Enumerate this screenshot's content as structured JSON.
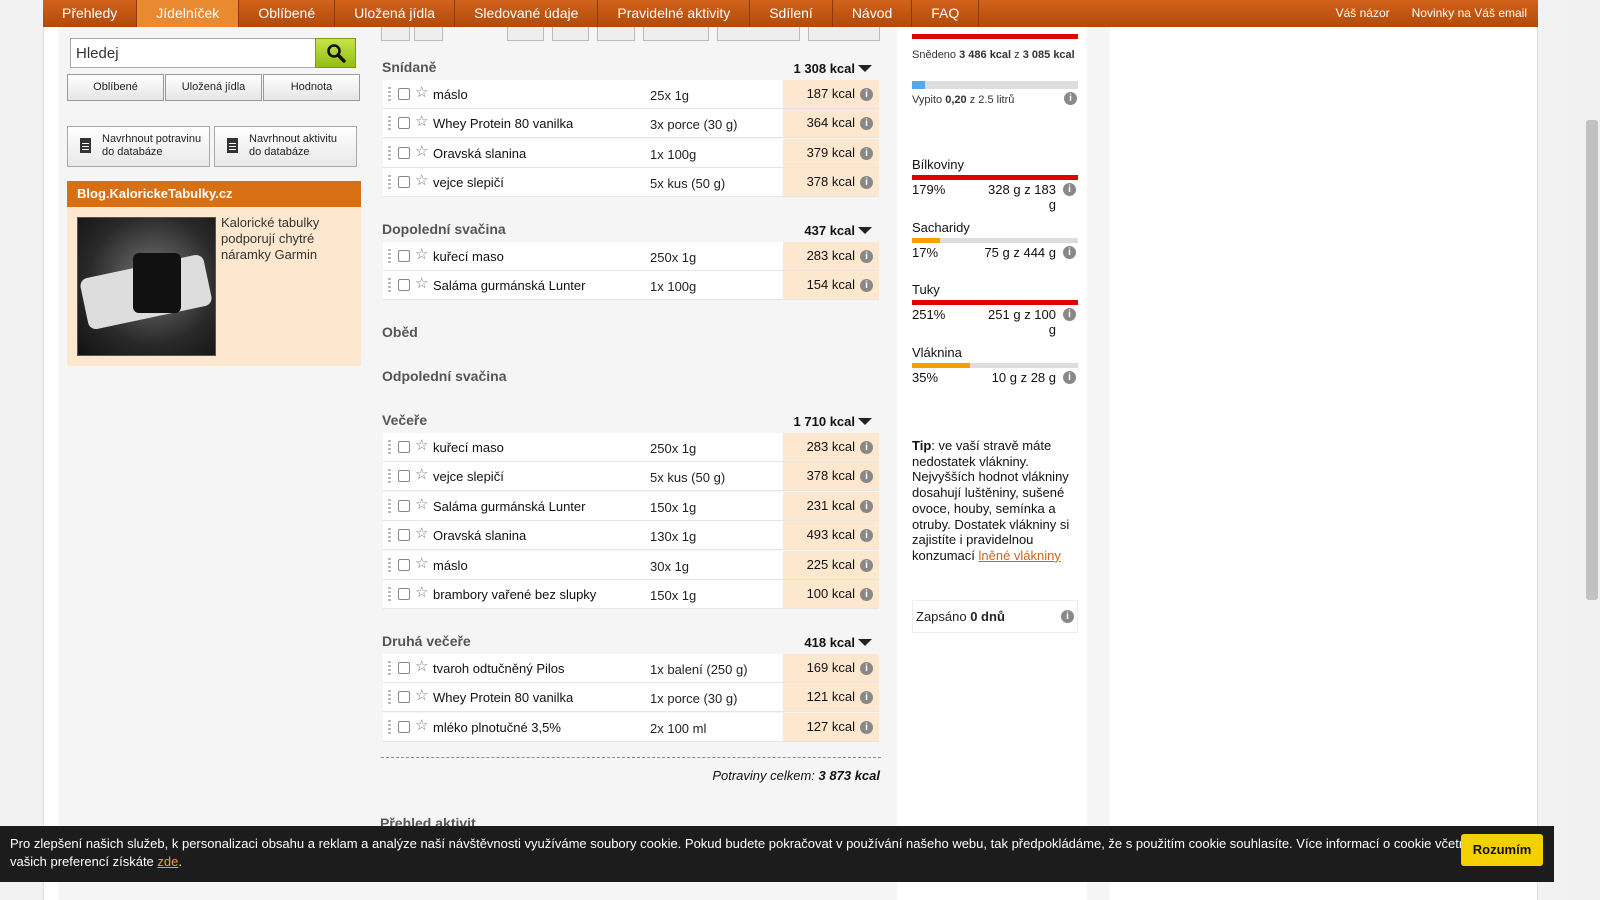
{
  "nav": {
    "tabs": [
      "Přehledy",
      "Jídelníček",
      "Oblíbené",
      "Uložená jídla",
      "Sledované údaje",
      "Pravidelné aktivity",
      "Sdílení",
      "Návod",
      "FAQ"
    ],
    "active_tab": "Jídelníček",
    "right_links": [
      "Váš názor",
      "Novinky na Váš email"
    ]
  },
  "search": {
    "value": "Hledej"
  },
  "filters": [
    "Oblíbené",
    "Uložená jídla",
    "Hodnota"
  ],
  "suggest": {
    "food": "Navrhnout potravinu do databáze",
    "food_l1": "Navrhnout potravinu",
    "food_l2": "do databáze",
    "activity_l1": "Navrhnout aktivitu",
    "activity_l2": "do databáze"
  },
  "blog": {
    "title": "Blog.KalorickeTabulky.cz",
    "text": "Kalorické tabulky podporují chytré náramky Garmin"
  },
  "meals": {
    "snidane": {
      "name": "Snídaně",
      "kcal": "1 308 kcal",
      "items": [
        {
          "food": "máslo",
          "amount": "25x 1g",
          "kcal": "187 kcal"
        },
        {
          "food": "Whey Protein 80 vanilka",
          "amount": "3x porce (30 g)",
          "kcal": "364 kcal"
        },
        {
          "food": "Oravská slanina",
          "amount": "1x 100g",
          "kcal": "379 kcal"
        },
        {
          "food": "vejce slepičí",
          "amount": "5x kus (50 g)",
          "kcal": "378 kcal"
        }
      ]
    },
    "dopoledni": {
      "name": "Dopolední svačina",
      "kcal": "437 kcal",
      "items": [
        {
          "food": "kuřecí maso",
          "amount": "250x 1g",
          "kcal": "283 kcal"
        },
        {
          "food": "Saláma gurmánská Lunter",
          "amount": "1x 100g",
          "kcal": "154 kcal"
        }
      ]
    },
    "obed": {
      "name": "Oběd"
    },
    "odpoledni": {
      "name": "Odpolední svačina"
    },
    "vecere": {
      "name": "Večeře",
      "kcal": "1 710 kcal",
      "items": [
        {
          "food": "kuřecí maso",
          "amount": "250x 1g",
          "kcal": "283 kcal"
        },
        {
          "food": "vejce slepičí",
          "amount": "5x kus (50 g)",
          "kcal": "378 kcal"
        },
        {
          "food": "Saláma gurmánská Lunter",
          "amount": "150x 1g",
          "kcal": "231 kcal"
        },
        {
          "food": "Oravská slanina",
          "amount": "130x 1g",
          "kcal": "493 kcal"
        },
        {
          "food": "máslo",
          "amount": "30x 1g",
          "kcal": "225 kcal"
        },
        {
          "food": "brambory vařené bez slupky",
          "amount": "150x 1g",
          "kcal": "100 kcal"
        }
      ]
    },
    "druha_vecere": {
      "name": "Druhá večeře",
      "kcal": "418 kcal",
      "items": [
        {
          "food": "tvaroh odtučněný Pilos",
          "amount": "1x balení (250 g)",
          "kcal": "169 kcal"
        },
        {
          "food": "Whey Protein 80 vanilka",
          "amount": "1x porce (30 g)",
          "kcal": "121 kcal"
        },
        {
          "food": "mléko plnotučné 3,5%",
          "amount": "2x 100 ml",
          "kcal": "127 kcal"
        }
      ]
    }
  },
  "total": {
    "label": "Potraviny celkem:",
    "value": "3 873 kcal"
  },
  "below_heading": "Přehled aktivit",
  "summary": {
    "eaten_prefix": "Snědeno",
    "eaten": "3 486 kcal",
    "eaten_mid": "z",
    "eaten_goal": "3 085 kcal",
    "drink_prefix": "Vypito",
    "drink": "0,20",
    "drink_suffix": "z 2.5 litrů",
    "drink_fraction": 0.08
  },
  "nutrients": [
    {
      "name": "Bílkoviny",
      "pct": "179%",
      "value": "328 g z 183 g",
      "fraction": 1.0,
      "color": "#e00000"
    },
    {
      "name": "Sacharidy",
      "pct": "17%",
      "value": "75 g z 444 g",
      "fraction": 0.17,
      "color": "#f5a000"
    },
    {
      "name": "Tuky",
      "pct": "251%",
      "value": "251 g z 100 g",
      "fraction": 1.0,
      "color": "#e00000"
    },
    {
      "name": "Vláknina",
      "pct": "35%",
      "value": "10 g z 28 g",
      "fraction": 0.35,
      "color": "#f5a000"
    }
  ],
  "tip": {
    "label": "Tip",
    "text": ": ve vaší stravě máte nedostatek vlákniny. Nejvyšších hodnot vlákniny dosahují luštěniny, sušené ovoce, houby, semínka a otruby. Dostatek vlákniny si zajistíte i pravidelnou konzumací ",
    "link": "lněné vlákniny"
  },
  "zapsano": {
    "prefix": "Zapsáno",
    "value": "0 dnů"
  },
  "cookie": {
    "text": "Pro zlepšení našich služeb, k personalizaci obsahu a reklam a analýze naší návštěvnosti využíváme soubory cookie. Pokud budete pokračovat v používání našeho webu, tak předpokládáme, že s použitím cookie souhlasíte. Více informací o cookie včetně nastavení vašich preferencí získáte ",
    "link": "zde",
    "end": ".",
    "button": "Rozumím"
  },
  "colors": {
    "nav": "#c0530f",
    "accent": "#e98a31",
    "kcal_bg": "#fde7ce",
    "search_btn": "#a8cc1e"
  }
}
